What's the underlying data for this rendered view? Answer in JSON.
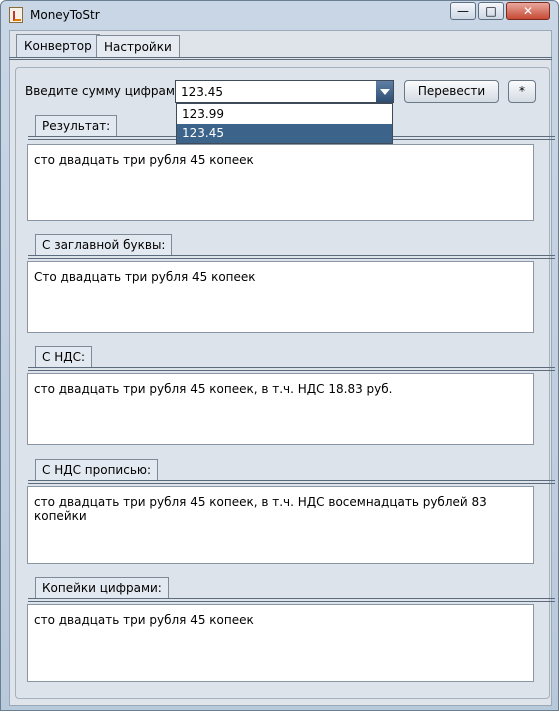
{
  "window": {
    "title": "MoneyToStr",
    "controls": {
      "minimize": "—",
      "maximize": "□",
      "close": "✕"
    }
  },
  "tabs": [
    {
      "label": "Конвертор",
      "active": true
    },
    {
      "label": "Настройки",
      "active": false
    }
  ],
  "input": {
    "prompt": "Введите сумму цифрами:",
    "value": "123.45",
    "options": [
      "123.99",
      "123.45"
    ],
    "selected_option": "123.45"
  },
  "buttons": {
    "translate": "Перевести",
    "star": "*"
  },
  "sections": [
    {
      "title": "Результат:",
      "text": "сто двадцать три рубля 45 копеек"
    },
    {
      "title": "С заглавной буквы:",
      "text": "Сто двадцать три рубля 45 копеек"
    },
    {
      "title": "С НДС:",
      "text": "сто двадцать три рубля 45 копеек, в т.ч. НДС 18.83 руб."
    },
    {
      "title": "С НДС прописью:",
      "text": "сто двадцать три рубля 45 копеек, в т.ч. НДС восемнадцать рублей 83 копейки"
    },
    {
      "title": "Копейки цифрами:",
      "text": "сто двадцать три рубля 45 копеек"
    }
  ],
  "colors": {
    "selection": "#3c6389",
    "combo_arrow": "#2f4e73"
  },
  "icons": {
    "app": "java-cup-icon",
    "dropdown_arrow": "chevron-down-icon"
  }
}
